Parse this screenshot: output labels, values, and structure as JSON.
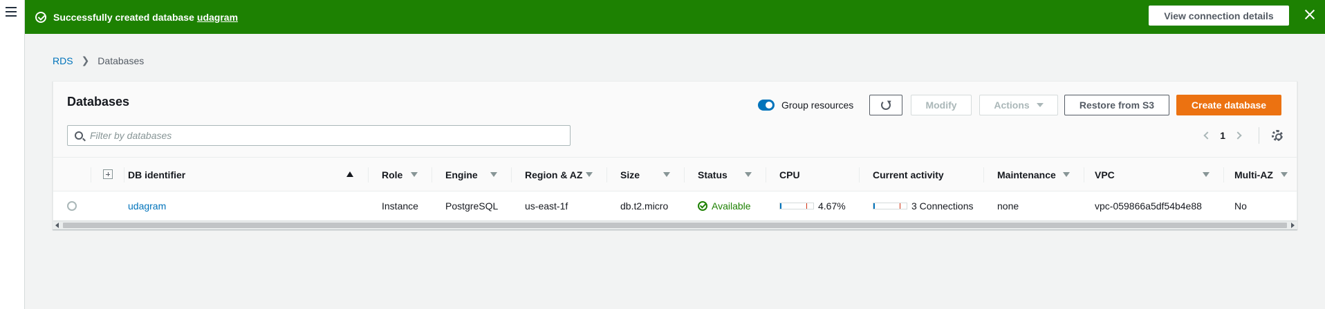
{
  "flash": {
    "message": "Successfully created database",
    "db_link": "udagram",
    "button_label": "View connection details"
  },
  "breadcrumb": {
    "root": "RDS",
    "current": "Databases"
  },
  "panel": {
    "title": "Databases",
    "group_resources_label": "Group resources",
    "group_resources_on": true,
    "buttons": {
      "modify": "Modify",
      "actions": "Actions",
      "restore": "Restore from S3",
      "create": "Create database"
    },
    "filter_placeholder": "Filter by databases",
    "page": "1"
  },
  "table": {
    "columns": {
      "db_identifier": "DB identifier",
      "role": "Role",
      "engine": "Engine",
      "region": "Region & AZ",
      "size": "Size",
      "status": "Status",
      "cpu": "CPU",
      "activity": "Current activity",
      "maintenance": "Maintenance",
      "vpc": "VPC",
      "multi_az": "Multi-AZ"
    },
    "rows": [
      {
        "db_identifier": "udagram",
        "role": "Instance",
        "engine": "PostgreSQL",
        "region": "us-east-1f",
        "size": "db.t2.micro",
        "status": "Available",
        "cpu": "4.67%",
        "cpu_fraction": 0.0467,
        "activity": "3 Connections",
        "maintenance": "none",
        "vpc": "vpc-059866a5df54b4e88",
        "multi_az": "No"
      }
    ]
  },
  "colors": {
    "flash_success": "#1d8102",
    "link": "#0073bb",
    "primary_button": "#ec7211",
    "status_available": "#1d8102"
  }
}
